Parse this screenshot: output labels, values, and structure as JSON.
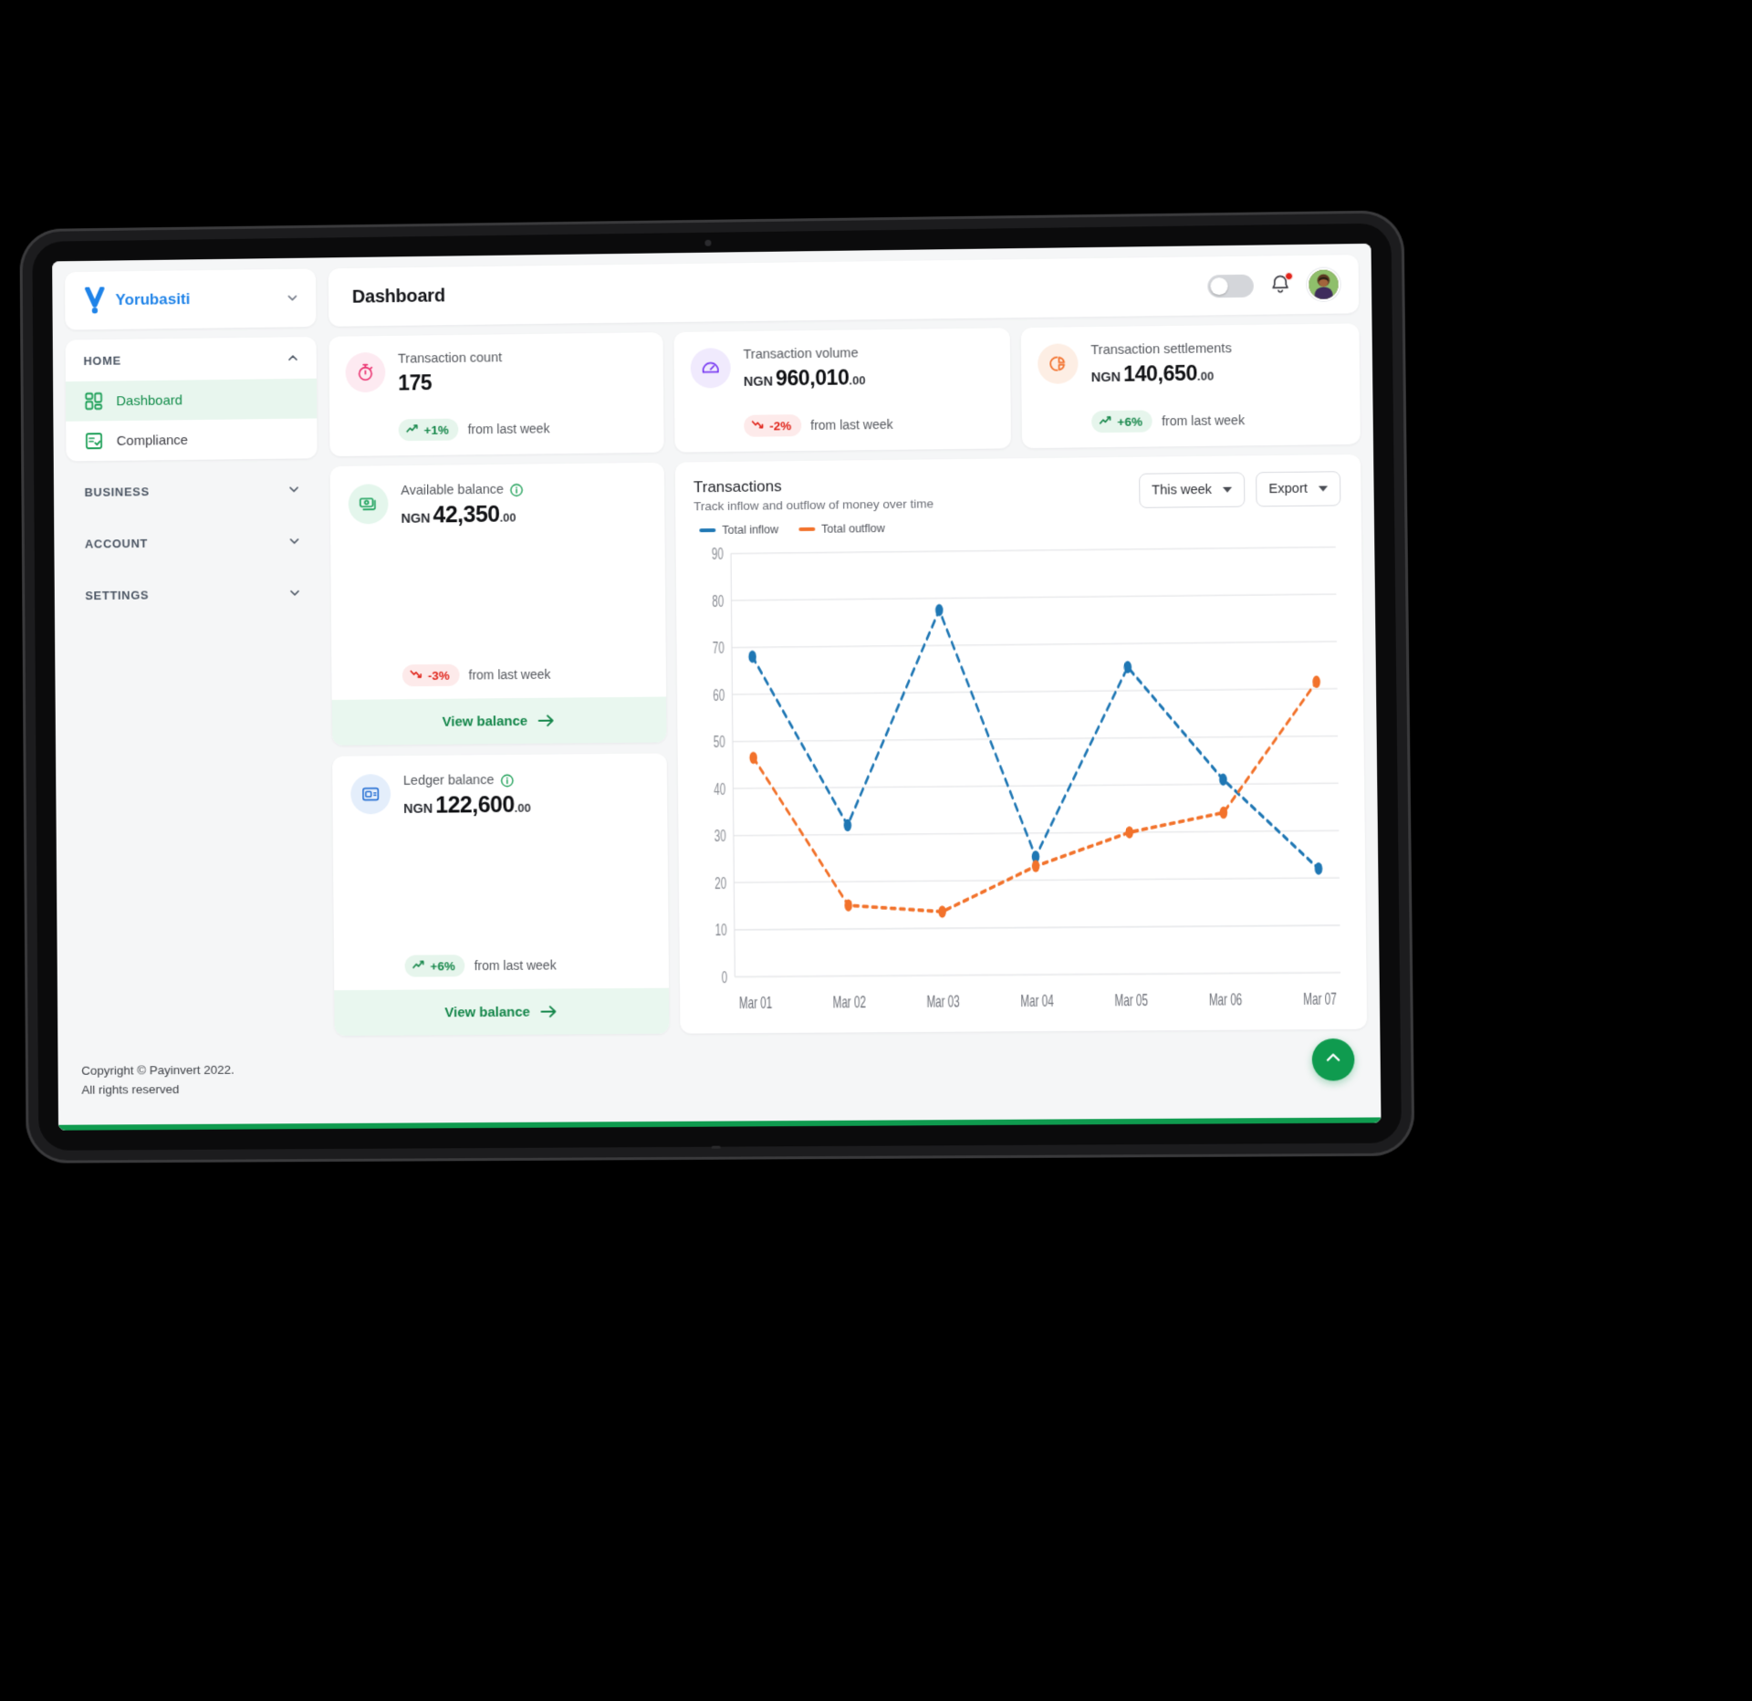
{
  "brand": {
    "name": "Yorubasiti",
    "logo_icon": "v-mark-logo",
    "chevron_icon": "chevron-down-icon",
    "color": "#1f83e8"
  },
  "sidebar": {
    "groups": [
      {
        "label": "HOME",
        "chevron_icon": "chevron-up-icon",
        "expanded": true,
        "items": [
          {
            "label": "Dashboard",
            "icon": "grid-dashboard-icon",
            "active": true
          },
          {
            "label": "Compliance",
            "icon": "checklist-document-icon",
            "active": false
          }
        ]
      },
      {
        "label": "BUSINESS",
        "chevron_icon": "chevron-down-icon",
        "expanded": false,
        "items": []
      },
      {
        "label": "ACCOUNT",
        "chevron_icon": "chevron-down-icon",
        "expanded": false,
        "items": []
      },
      {
        "label": "SETTINGS",
        "chevron_icon": "chevron-down-icon",
        "expanded": false,
        "items": []
      }
    ]
  },
  "topbar": {
    "title": "Dashboard",
    "toggle": {
      "icon": "mode-toggle",
      "state": "off"
    },
    "notification": {
      "icon": "bell-icon",
      "has_unread": true,
      "dot_color": "#e2231a"
    },
    "avatar": {
      "icon": "user-avatar"
    }
  },
  "kpis": [
    {
      "label": "Transaction count",
      "currency": "",
      "value": "175",
      "cents": "",
      "icon": "stopwatch-icon",
      "icon_color": "#ea2f6e",
      "icon_bg": "#fdeaf1",
      "delta": "+1%",
      "delta_dir": "up",
      "delta_note": "from last week"
    },
    {
      "label": "Transaction volume",
      "currency": "NGN",
      "value": "960,010",
      "cents": ".00",
      "icon": "speedometer-icon",
      "icon_color": "#7b3ff2",
      "icon_bg": "#f0eafd",
      "delta": "-2%",
      "delta_dir": "down",
      "delta_note": "from last week"
    },
    {
      "label": "Transaction settlements",
      "currency": "NGN",
      "value": "140,650",
      "cents": ".00",
      "icon": "pie-chart-icon",
      "icon_color": "#f2712c",
      "icon_bg": "#fdeee4",
      "delta": "+6%",
      "delta_dir": "up",
      "delta_note": "from last week"
    }
  ],
  "balances": [
    {
      "label": "Available balance",
      "info_icon": "info-circle-icon",
      "currency": "NGN",
      "value": "42,350",
      "cents": ".00",
      "icon": "banknotes-icon",
      "icon_color": "#19a05a",
      "icon_bg": "#e4f6ec",
      "delta": "-3%",
      "delta_dir": "down",
      "delta_note": "from last week",
      "action_label": "View balance",
      "action_icon": "arrow-right-icon"
    },
    {
      "label": "Ledger balance",
      "info_icon": "info-circle-icon",
      "currency": "NGN",
      "value": "122,600",
      "cents": ".00",
      "icon": "wallet-card-icon",
      "icon_color": "#2a72d4",
      "icon_bg": "#e4eefb",
      "delta": "+6%",
      "delta_dir": "up",
      "delta_note": "from last week",
      "action_label": "View balance",
      "action_icon": "arrow-right-icon"
    }
  ],
  "chart_card": {
    "title": "Transactions",
    "subtitle": "Track inflow and outflow of money over time",
    "range_button": {
      "label": "This week",
      "icon": "caret-down-icon"
    },
    "export_button": {
      "label": "Export",
      "icon": "caret-down-icon"
    }
  },
  "chart_data": {
    "type": "line",
    "title": "Transactions",
    "subtitle": "Track inflow and outflow of money over time",
    "xlabel": "",
    "ylabel": "",
    "x": [
      "Mar 01",
      "Mar 02",
      "Mar 03",
      "Mar 04",
      "Mar 05",
      "Mar 06",
      "Mar 07"
    ],
    "categories": [
      "Mar 01",
      "Mar 02",
      "Mar 03",
      "Mar 04",
      "Mar 05",
      "Mar 06",
      "Mar 07"
    ],
    "series": [
      {
        "name": "Total inflow",
        "color": "#1f77b4",
        "style": "dotted",
        "marker": "circle",
        "values": [
          68,
          32,
          77.5,
          25,
          65,
          41,
          22
        ]
      },
      {
        "name": "Total outflow",
        "color": "#f2722b",
        "style": "dotted",
        "marker": "circle",
        "values": [
          46.5,
          15,
          13.5,
          23,
          30,
          34,
          61.5
        ]
      }
    ],
    "ylim": [
      0,
      90
    ],
    "yticks": [
      0,
      10,
      20,
      30,
      40,
      50,
      60,
      70,
      80,
      90
    ],
    "ytick_labels": [
      "0",
      "10",
      "20",
      "30",
      "40",
      "50",
      "60",
      "70",
      "80",
      "90"
    ],
    "grid": "horizontal",
    "legend_position": "top-left"
  },
  "footer": {
    "line1": "Copyright © Payinvert 2022.",
    "line2": "All rights reserved",
    "scroll_top_icon": "chevron-up-icon"
  }
}
